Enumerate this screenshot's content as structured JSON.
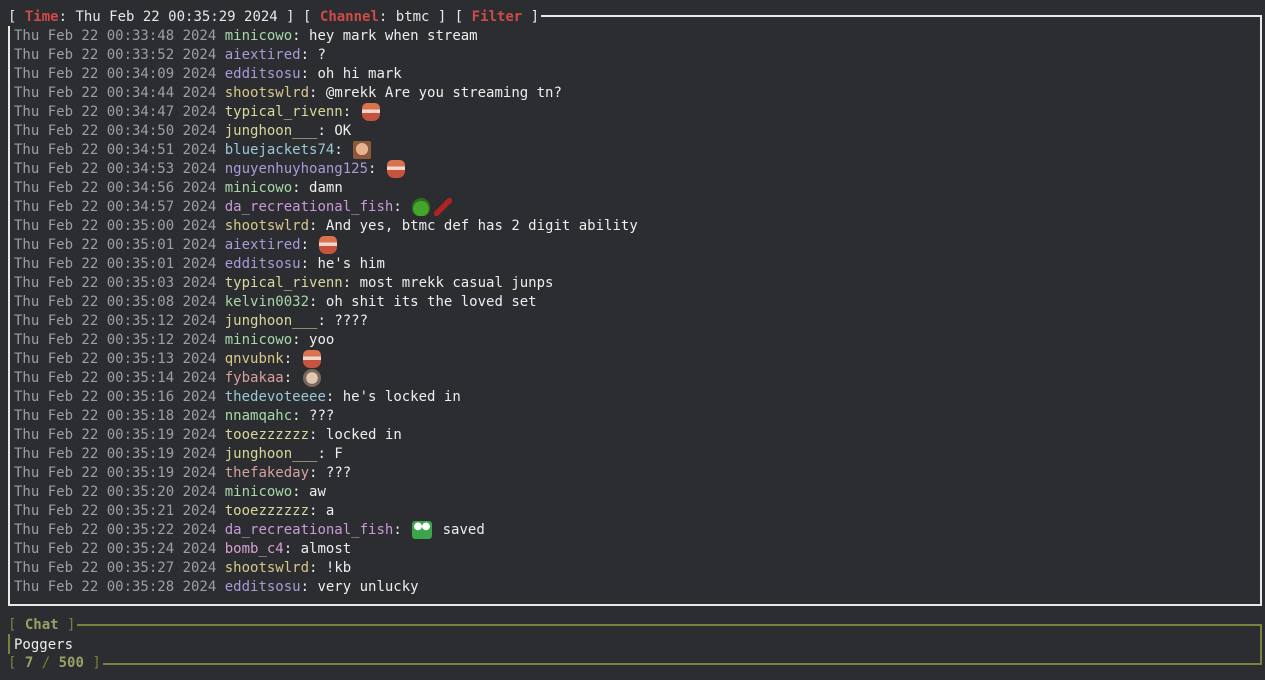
{
  "header": {
    "time_label": "Time",
    "time_value": "Thu Feb 22 00:35:29 2024",
    "channel_label": "Channel",
    "channel_value": "btmc",
    "filter_label": "Filter"
  },
  "messages": [
    {
      "ts": "Thu Feb 22 00:33:48 2024",
      "user": "minicowo",
      "color": "#a8d8a8",
      "text": "hey mark when stream",
      "emotes": []
    },
    {
      "ts": "Thu Feb 22 00:33:52 2024",
      "user": "aiextired",
      "color": "#a99bd8",
      "text": "?",
      "emotes": []
    },
    {
      "ts": "Thu Feb 22 00:34:09 2024",
      "user": "edditsosu",
      "color": "#a99bd8",
      "text": "oh hi mark",
      "emotes": []
    },
    {
      "ts": "Thu Feb 22 00:34:44 2024",
      "user": "shootswlrd",
      "color": "#d8c88a",
      "text": "@mrekk Are you streaming tn?",
      "emotes": []
    },
    {
      "ts": "Thu Feb 22 00:34:47 2024",
      "user": "typical_rivenn",
      "color": "#d8d89a",
      "text": "",
      "emotes": [
        "mouth"
      ]
    },
    {
      "ts": "Thu Feb 22 00:34:50 2024",
      "user": "junghoon___",
      "color": "#d8d89a",
      "text": "OK",
      "emotes": []
    },
    {
      "ts": "Thu Feb 22 00:34:51 2024",
      "user": "bluejackets74",
      "color": "#9ac8d8",
      "text": "",
      "emotes": [
        "face"
      ]
    },
    {
      "ts": "Thu Feb 22 00:34:53 2024",
      "user": "nguyenhuyhoang125",
      "color": "#a99bd8",
      "text": "",
      "emotes": [
        "mouth"
      ]
    },
    {
      "ts": "Thu Feb 22 00:34:56 2024",
      "user": "minicowo",
      "color": "#a8d8a8",
      "text": "damn",
      "emotes": []
    },
    {
      "ts": "Thu Feb 22 00:34:57 2024",
      "user": "da_recreational_fish",
      "color": "#c89ad8",
      "text": "",
      "emotes": [
        "frog",
        "guitar"
      ]
    },
    {
      "ts": "Thu Feb 22 00:35:00 2024",
      "user": "shootswlrd",
      "color": "#d8c88a",
      "text": "And yes, btmc def has 2 digit ability",
      "emotes": []
    },
    {
      "ts": "Thu Feb 22 00:35:01 2024",
      "user": "aiextired",
      "color": "#a99bd8",
      "text": "",
      "emotes": [
        "mouth"
      ]
    },
    {
      "ts": "Thu Feb 22 00:35:01 2024",
      "user": "edditsosu",
      "color": "#a99bd8",
      "text": "he's him",
      "emotes": []
    },
    {
      "ts": "Thu Feb 22 00:35:03 2024",
      "user": "typical_rivenn",
      "color": "#d8d89a",
      "text": "most mrekk casual junps",
      "emotes": []
    },
    {
      "ts": "Thu Feb 22 00:35:08 2024",
      "user": "kelvin0032",
      "color": "#a8d8a8",
      "text": "oh shit its the loved set",
      "emotes": []
    },
    {
      "ts": "Thu Feb 22 00:35:12 2024",
      "user": "junghoon___",
      "color": "#d8d89a",
      "text": "????",
      "emotes": []
    },
    {
      "ts": "Thu Feb 22 00:35:12 2024",
      "user": "minicowo",
      "color": "#a8d8a8",
      "text": "yoo",
      "emotes": []
    },
    {
      "ts": "Thu Feb 22 00:35:13 2024",
      "user": "qnvubnk",
      "color": "#d8c88a",
      "text": "",
      "emotes": [
        "mouth"
      ]
    },
    {
      "ts": "Thu Feb 22 00:35:14 2024",
      "user": "fybakaa",
      "color": "#d8a0a0",
      "text": "",
      "emotes": [
        "pepe"
      ]
    },
    {
      "ts": "Thu Feb 22 00:35:16 2024",
      "user": "thedevoteeee",
      "color": "#9ac8d8",
      "text": "he's locked in",
      "emotes": []
    },
    {
      "ts": "Thu Feb 22 00:35:18 2024",
      "user": "nnamqahc",
      "color": "#a8d8a8",
      "text": "???",
      "emotes": []
    },
    {
      "ts": "Thu Feb 22 00:35:19 2024",
      "user": "tooezzzzzz",
      "color": "#d8d89a",
      "text": "locked in",
      "emotes": []
    },
    {
      "ts": "Thu Feb 22 00:35:19 2024",
      "user": "junghoon___",
      "color": "#d8d89a",
      "text": "F",
      "emotes": []
    },
    {
      "ts": "Thu Feb 22 00:35:19 2024",
      "user": "thefakeday",
      "color": "#d8a0a0",
      "text": "???",
      "emotes": []
    },
    {
      "ts": "Thu Feb 22 00:35:20 2024",
      "user": "minicowo",
      "color": "#a8d8a8",
      "text": "aw",
      "emotes": []
    },
    {
      "ts": "Thu Feb 22 00:35:21 2024",
      "user": "tooezzzzzz",
      "color": "#d8d89a",
      "text": "a",
      "emotes": []
    },
    {
      "ts": "Thu Feb 22 00:35:22 2024",
      "user": "da_recreational_fish",
      "color": "#c89ad8",
      "text": "saved",
      "emotes": [
        "bigfrog"
      ]
    },
    {
      "ts": "Thu Feb 22 00:35:24 2024",
      "user": "bomb_c4",
      "color": "#d8a0d0",
      "text": "almost",
      "emotes": []
    },
    {
      "ts": "Thu Feb 22 00:35:27 2024",
      "user": "shootswlrd",
      "color": "#d8c88a",
      "text": "!kb",
      "emotes": []
    },
    {
      "ts": "Thu Feb 22 00:35:28 2024",
      "user": "edditsosu",
      "color": "#a99bd8",
      "text": "very unlucky",
      "emotes": []
    }
  ],
  "chat": {
    "title": "Chat",
    "input_value": "Poggers",
    "counter_current": "7",
    "counter_max": "500"
  },
  "colors": {
    "border_main": "#e8e8e8",
    "border_chat": "#7b8240",
    "header_accent": "#d04a4a",
    "timestamp": "#9aa0a6",
    "background": "#2b2d30"
  }
}
